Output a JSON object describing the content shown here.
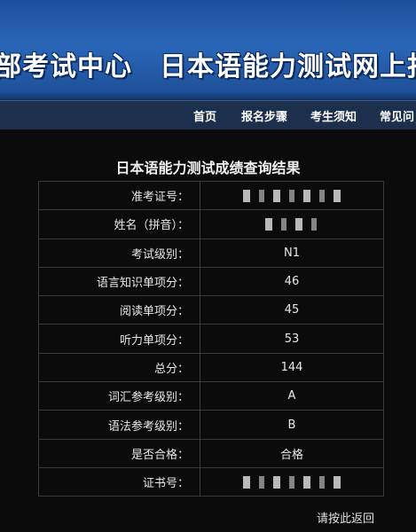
{
  "header": {
    "banner_title": "部考试中心　日本语能力测试网上报名"
  },
  "nav": {
    "items": [
      "首页",
      "报名步骤",
      "考生须知",
      "常见问"
    ]
  },
  "result": {
    "title": "日本语能力测试成绩查询结果",
    "rows": [
      {
        "label": "准考证号：",
        "value": ""
      },
      {
        "label": "姓名（拼音）：",
        "value": ""
      },
      {
        "label": "考试级别：",
        "value": "N1"
      },
      {
        "label": "语言知识单项分：",
        "value": "46"
      },
      {
        "label": "阅读单项分：",
        "value": "45"
      },
      {
        "label": "听力单项分：",
        "value": "53"
      },
      {
        "label": "总分：",
        "value": "144"
      },
      {
        "label": "词汇参考级别：",
        "value": "A"
      },
      {
        "label": "语法参考级别：",
        "value": "B"
      },
      {
        "label": "是否合格：",
        "value": "合格"
      },
      {
        "label": "证书号：",
        "value": ""
      }
    ]
  },
  "footer": {
    "back_label": "请按此返回"
  },
  "colors": {
    "banner_blue": "#2a66b8",
    "navbar": "#1c2f4d",
    "background": "#0b0b0b"
  }
}
